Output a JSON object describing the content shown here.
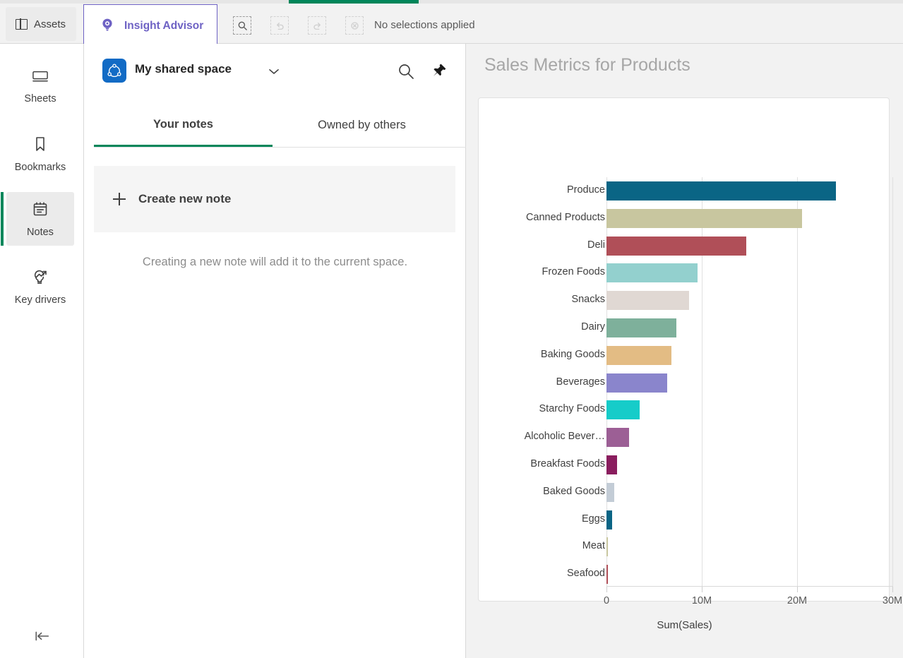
{
  "progress": {
    "percent": 14
  },
  "topbar": {
    "assets_label": "Assets",
    "assets_icon": "panel-layout-icon",
    "insight_advisor_label": "Insight Advisor",
    "insight_advisor_icon": "insight-lightbulb-icon",
    "tools": [
      {
        "name": "selection-search-icon",
        "enabled": true
      },
      {
        "name": "undo-icon",
        "enabled": false
      },
      {
        "name": "redo-icon",
        "enabled": false
      },
      {
        "name": "clear-selections-icon",
        "enabled": false
      }
    ],
    "selections_status": "No selections applied"
  },
  "left_rail": {
    "items": [
      {
        "label": "Sheets",
        "icon": "sheets-icon",
        "active": false
      },
      {
        "label": "Bookmarks",
        "icon": "bookmark-icon",
        "active": false
      },
      {
        "label": "Notes",
        "icon": "notes-icon",
        "active": true
      },
      {
        "label": "Key drivers",
        "icon": "key-drivers-icon",
        "active": false
      }
    ],
    "collapse_icon": "collapse-left-icon"
  },
  "notes_panel": {
    "space_name": "My shared space",
    "space_icon": "shared-space-icon",
    "chevron_icon": "chevron-down-icon",
    "search_icon": "search-icon",
    "pin_icon": "pin-icon",
    "tabs": [
      {
        "label": "Your notes",
        "active": true
      },
      {
        "label": "Owned by others",
        "active": false
      }
    ],
    "create_note_label": "Create new note",
    "create_note_icon": "plus-icon",
    "empty_hint": "Creating a new note will add it to the current space."
  },
  "content": {
    "heading": "Sales Metrics for Products"
  },
  "chart_data": {
    "type": "bar",
    "orientation": "horizontal",
    "title": "Sales Metrics for Products",
    "xlabel": "Sum(Sales)",
    "ylabel": "",
    "xlim": [
      0,
      30000000
    ],
    "xticks": [
      0,
      10000000,
      20000000,
      30000000
    ],
    "xtick_labels": [
      "0",
      "10M",
      "20M",
      "30M"
    ],
    "grid": true,
    "legend": false,
    "categories": [
      "Produce",
      "Canned Products",
      "Deli",
      "Frozen Foods",
      "Snacks",
      "Dairy",
      "Baking Goods",
      "Beverages",
      "Starchy Foods",
      "Alcoholic Bever…",
      "Breakfast Foods",
      "Baked Goods",
      "Eggs",
      "Meat",
      "Seafood"
    ],
    "values": [
      24100000,
      20500000,
      14700000,
      9550000,
      8700000,
      7300000,
      6800000,
      6400000,
      3500000,
      2400000,
      1100000,
      800000,
      600000,
      150000,
      150000
    ],
    "colors": [
      "#0a6585",
      "#c8c69f",
      "#b04f58",
      "#93d0ce",
      "#e0d8d3",
      "#7eb09b",
      "#e3bc84",
      "#8a85cc",
      "#16ccc9",
      "#9c5f95",
      "#8a1d5e",
      "#c3ccd6",
      "#0a6585",
      "#c8c69f",
      "#b04f58"
    ]
  }
}
